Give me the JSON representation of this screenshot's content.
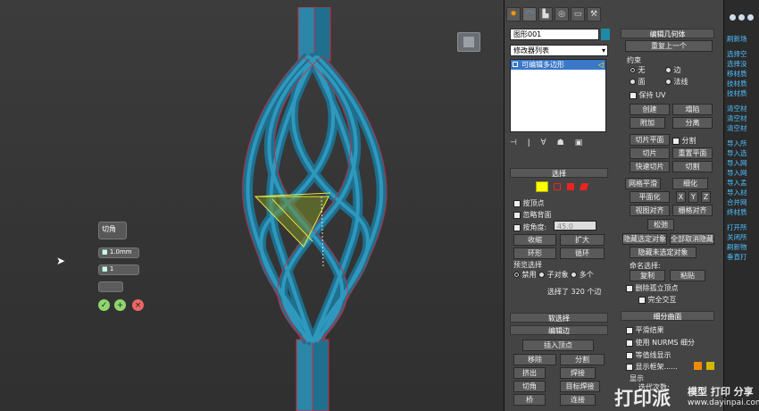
{
  "viewport": {
    "label": "",
    "caddy": {
      "title": "切角",
      "amount": "1.0mm",
      "segments": "1"
    }
  },
  "modify": {
    "object_name": "图形001",
    "modifier_list": "修改器列表",
    "stack_item": "可编辑多边形"
  },
  "edit_geometry": {
    "title": "编辑几何体",
    "repeat_last": "重复上一个",
    "constraints": "约束",
    "none": "无",
    "edge": "边",
    "face": "面",
    "normal": "法线",
    "preserve_uvs": "保持 UV",
    "create": "创建",
    "collapse": "塌陷",
    "attach": "附加",
    "detach": "分离",
    "slice_plane": "切片平面",
    "split": "分割",
    "slice": "切片",
    "reset_plane": "重置平面",
    "quickslice": "快速切片",
    "cut": "切割",
    "meshsmooth": "网格平滑",
    "tessellate": "细化",
    "make_planar": "平面化",
    "x": "X",
    "y": "Y",
    "z": "Z",
    "view_align": "视图对齐",
    "grid_align": "栅格对齐",
    "relax": "松弛",
    "hide_selected": "隐藏选定对象",
    "unhide_all": "全部取消隐藏",
    "hide_unselected": "隐藏未选定对象",
    "named_sel": "命名选择:",
    "copy": "复制",
    "paste": "粘贴",
    "delete_isolated": "删除孤立顶点",
    "full_interactivity": "完全交互"
  },
  "selection": {
    "title": "选择",
    "by_vertex": "按顶点",
    "ignore_backfacing": "忽略背面",
    "by_angle": "按角度:",
    "angle_value": "45.0",
    "shrink": "收缩",
    "grow": "扩大",
    "ring": "环形",
    "loop": "循环",
    "preview": "预览选择",
    "disabled": "禁用",
    "subobject": "子对象",
    "multi": "多个",
    "status": "选择了 320 个边"
  },
  "soft_selection": {
    "title": "软选择"
  },
  "edit_edges": {
    "title": "编辑边",
    "insert_vertex": "插入顶点",
    "remove": "移除",
    "split": "分割",
    "extrude": "挤出",
    "weld": "焊接",
    "chamfer": "切角",
    "target_weld": "目标焊接",
    "bridge": "桥",
    "connect": "连接"
  },
  "subdivision": {
    "title": "细分曲面",
    "smooth_result": "平滑结果",
    "use_nurms": "使用 NURMS 细分",
    "isoline": "等值线显示",
    "show_cage": "显示框架......",
    "display": "显示",
    "iterations": "迭代次数:"
  },
  "right_panel": {
    "lines": [
      "刷新场",
      "",
      "选择空",
      "选择没",
      "移材质",
      "技材质",
      "技材质",
      "",
      "清空材",
      "清空材",
      "清空材",
      "",
      "导入所",
      "导入选",
      "导入网",
      "导入网",
      "导入孟",
      "导入材",
      "合并网",
      "终材质",
      "",
      "打开所",
      "关闭所",
      "刷新物",
      "垂直打"
    ]
  },
  "watermark": {
    "brand": "打印派",
    "tagline": "模型 打印 分享",
    "url": "www.dayinpai.com"
  },
  "colors": {
    "model": "#1f6f8e",
    "edge_sel": "#d2283c",
    "gizmo": "#e8e83a",
    "accent": "#3a78c8"
  }
}
